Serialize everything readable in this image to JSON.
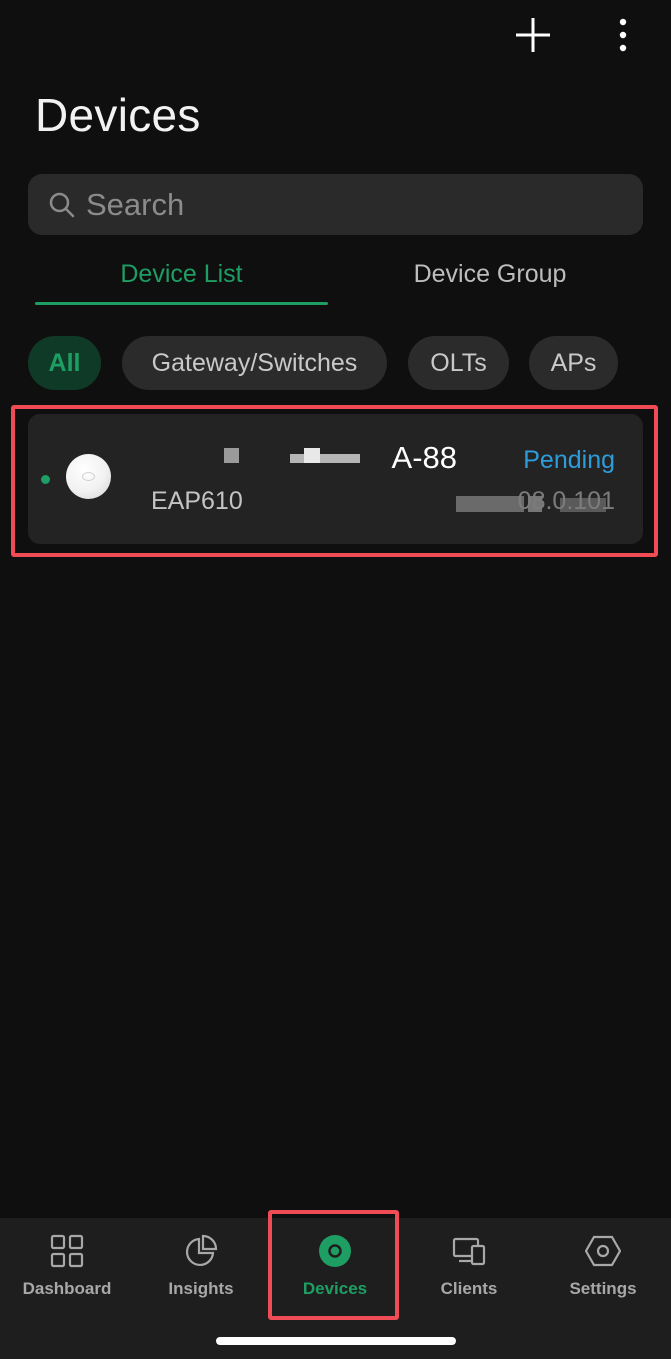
{
  "header": {
    "title": "Devices",
    "add_icon": "plus-icon",
    "more_icon": "more-vertical-icon"
  },
  "search": {
    "placeholder": "Search",
    "icon": "search-icon"
  },
  "tabs": [
    {
      "label": "Device List",
      "active": true
    },
    {
      "label": "Device Group",
      "active": false
    }
  ],
  "filters": [
    {
      "label": "All",
      "active": true
    },
    {
      "label": "Gateway/Switches",
      "active": false
    },
    {
      "label": "OLTs",
      "active": false
    },
    {
      "label": "APs",
      "active": false
    }
  ],
  "devices": [
    {
      "name_visible": "A-88",
      "status": "Pending",
      "model": "EAP610",
      "ip_visible": "08.0.101",
      "online_dot_color": "#1e9e63"
    }
  ],
  "bottom_nav": [
    {
      "label": "Dashboard",
      "icon": "dashboard-grid-icon",
      "active": false
    },
    {
      "label": "Insights",
      "icon": "pie-chart-icon",
      "active": false
    },
    {
      "label": "Devices",
      "icon": "devices-circle-icon",
      "active": true
    },
    {
      "label": "Clients",
      "icon": "clients-monitor-icon",
      "active": false
    },
    {
      "label": "Settings",
      "icon": "hexagon-settings-icon",
      "active": false
    }
  ],
  "colors": {
    "accent": "#1e9e63",
    "pending": "#2d9cdb",
    "highlight": "#ef4c55",
    "background": "#0f0f0f"
  }
}
